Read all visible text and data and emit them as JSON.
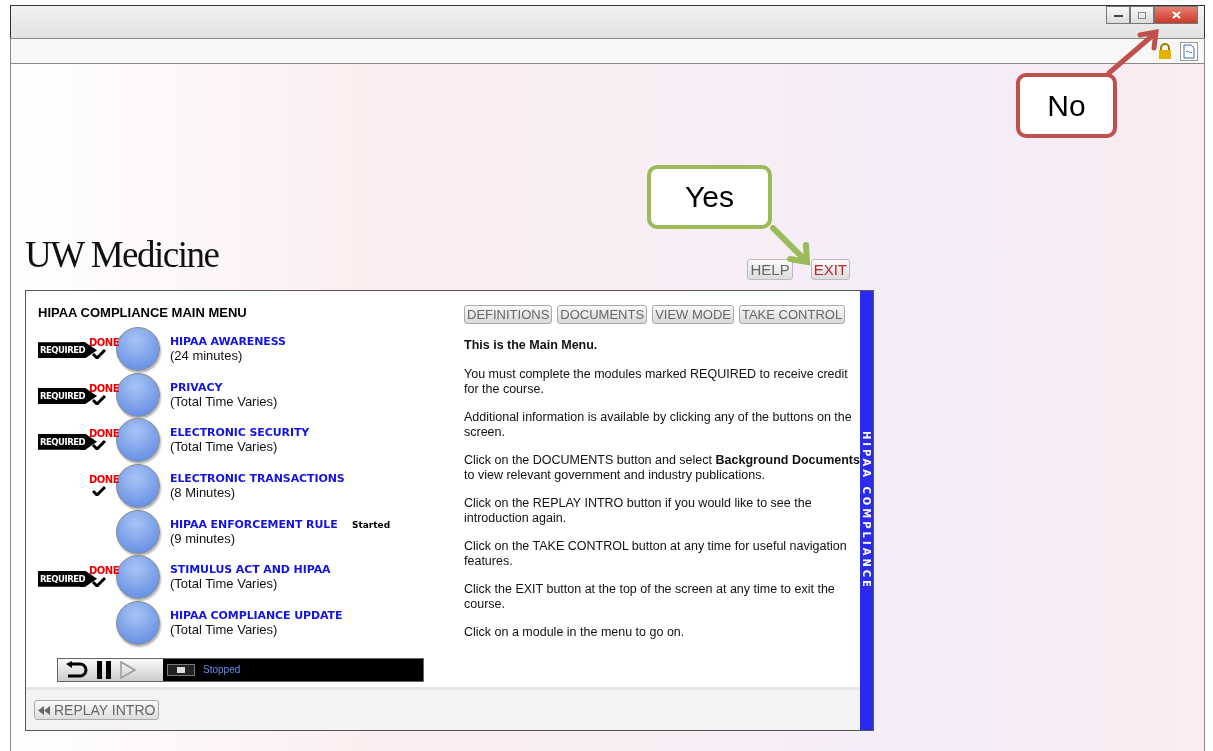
{
  "logo": "UW Medicine",
  "top_buttons": [
    {
      "label": "HELP",
      "kind": "plain"
    },
    {
      "label": "EXIT",
      "kind": "exit"
    }
  ],
  "menu": {
    "title": "HIPAA COMPLIANCE MAIN MENU",
    "modules": [
      {
        "title": "HIPAA AWARENESS",
        "duration": "(24 minutes)",
        "required_tag": "REQUIRED",
        "done_tag": "DONE"
      },
      {
        "title": "PRIVACY",
        "duration": "(Total Time Varies)",
        "required_tag": "REQUIRED",
        "done_tag": "DONE"
      },
      {
        "title": "ELECTRONIC SECURITY",
        "duration": "(Total Time Varies)",
        "required_tag": "REQUIRED",
        "done_tag": "DONE"
      },
      {
        "title": "ELECTRONIC TRANSACTIONS",
        "duration": "(8 Minutes)",
        "done_tag": "DONE"
      },
      {
        "title": "HIPAA ENFORCEMENT RULE",
        "duration": "(9 minutes)",
        "status": "Started"
      },
      {
        "title": "STIMULUS ACT AND HIPAA",
        "duration": "(Total Time Varies)",
        "required_tag": "REQUIRED",
        "done_tag": "DONE"
      },
      {
        "title": "HIPAA COMPLIANCE UPDATE",
        "duration": "(Total Time Varies)"
      }
    ]
  },
  "player": {
    "status": "Stopped",
    "play_disabled": true
  },
  "tool_buttons": [
    "DEFINITIONS",
    "DOCUMENTS",
    "VIEW MODE",
    "TAKE CONTROL"
  ],
  "info": {
    "heading": "This is the Main Menu.",
    "paragraphs": [
      "You must complete the modules marked REQUIRED to receive credit for the course.",
      "Additional information is available by clicking any of the buttons on the screen.",
      "Click on the DOCUMENTS button and select **Background Documents** to view relevant government and industry publications.",
      "Click on the REPLAY INTRO button if you would like to see the introduction again.",
      "Click on the TAKE CONTROL button at any time for useful navigation features.",
      "Click the EXIT button at the top of the screen at any time to exit the course.",
      "Click on a module in the menu to go on."
    ]
  },
  "side_banner": "HIPAA COMPLIANCE",
  "replay_button": "REPLAY INTRO",
  "callouts": [
    {
      "text": "Yes",
      "kind": "yes"
    },
    {
      "text": "No",
      "kind": "no"
    }
  ]
}
